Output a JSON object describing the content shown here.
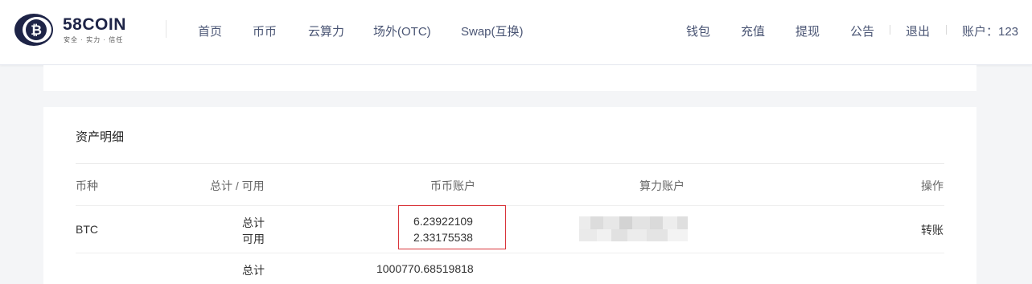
{
  "brand": {
    "name": "58COIN",
    "slogan": "安全 · 实力 · 信任"
  },
  "nav_left": [
    "首页",
    "币币",
    "云算力",
    "场外(OTC)",
    "Swap(互换)"
  ],
  "nav_right": {
    "wallet": "钱包",
    "deposit": "充值",
    "withdraw": "提现",
    "notice": "公告",
    "logout": "退出",
    "account": "账户：123"
  },
  "assets": {
    "title": "资产明细",
    "columns": {
      "coin": "币种",
      "total_available": "总计 / 可用",
      "spot_account": "币币账户",
      "hash_account": "算力账户",
      "action": "操作"
    },
    "rows": [
      {
        "coin": "BTC",
        "total_label": "总计",
        "available_label": "可用",
        "spot_total": "6.23922109",
        "spot_available": "2.33175538",
        "action": "转账"
      }
    ],
    "partial_row": {
      "total_label": "总计",
      "spot_total": "1000770.68519818"
    }
  },
  "colors": {
    "brand_navy": "#1e2447",
    "nav_text": "#4a5574",
    "highlight_border": "#d9343a"
  },
  "icons": {
    "logo": "bitcoin-coin-icon"
  }
}
